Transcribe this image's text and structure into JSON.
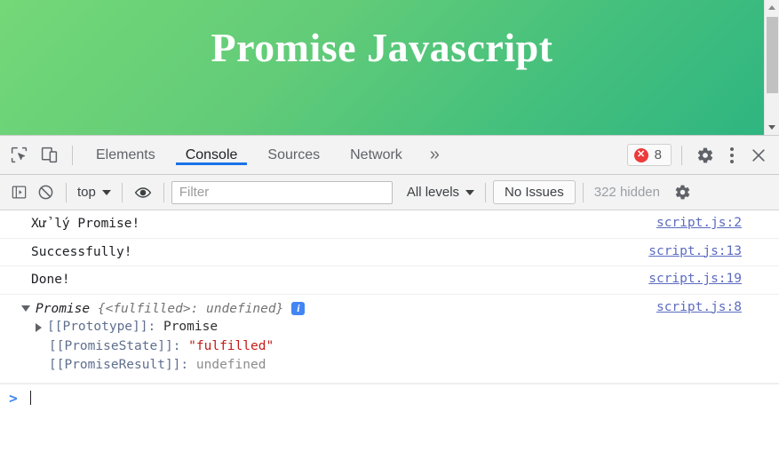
{
  "page": {
    "title": "Promise Javascript",
    "gradient_from": "#74d878",
    "gradient_to": "#2fb581"
  },
  "devtools": {
    "toolbar_icons": {
      "inspect": "inspect-element-icon",
      "device": "device-toolbar-icon"
    },
    "tabs": [
      {
        "label": "Elements",
        "active": false
      },
      {
        "label": "Console",
        "active": true
      },
      {
        "label": "Sources",
        "active": false
      },
      {
        "label": "Network",
        "active": false
      }
    ],
    "more_tabs_glyph": "»",
    "errors": {
      "count": "8",
      "glyph": "✕"
    },
    "accent_color": "#1a73e8",
    "error_color": "#ec3b3b"
  },
  "console_toolbar": {
    "sidebar_toggle": "console-sidebar-icon",
    "clear_console": "clear-console-icon",
    "context": "top",
    "eye": "live-expression-icon",
    "filter": {
      "value": "",
      "placeholder": "Filter"
    },
    "levels": "All levels",
    "issues_button": "No Issues",
    "hidden_messages": "322 hidden",
    "settings": "gear-icon"
  },
  "console_messages": [
    {
      "text": "Xử lý Promise!",
      "source": "script.js:2"
    },
    {
      "text": "Successfully!",
      "source": "script.js:13"
    },
    {
      "text": "Done!",
      "source": "script.js:19"
    }
  ],
  "promise_object": {
    "source": "script.js:8",
    "label": "Promise",
    "preview": " {<fulfilled>: undefined}",
    "info_glyph": "i",
    "props": [
      {
        "key": "[[Prototype]]",
        "sep": ": ",
        "value": "Promise",
        "kind": "plain",
        "expandable": true
      },
      {
        "key": "[[PromiseState]]",
        "sep": ": ",
        "value": "\"fulfilled\"",
        "kind": "string",
        "expandable": false
      },
      {
        "key": "[[PromiseResult]]",
        "sep": ": ",
        "value": "undefined",
        "kind": "undefined",
        "expandable": false
      }
    ]
  },
  "prompt": {
    "caret": ">"
  }
}
